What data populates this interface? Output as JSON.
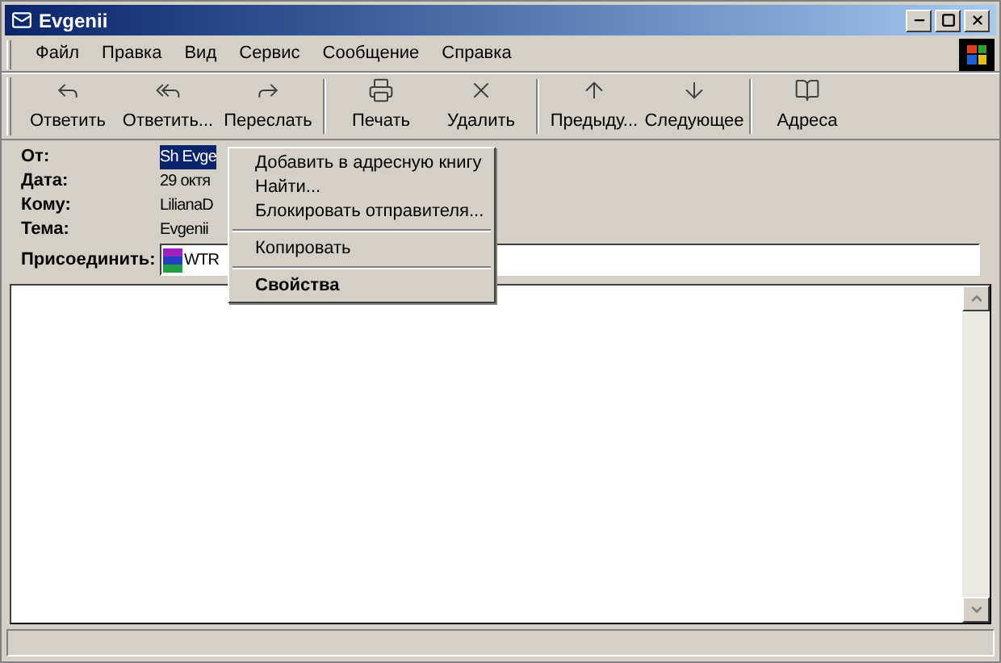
{
  "window": {
    "title": "Evgenii"
  },
  "menu_bar": [
    "Файл",
    "Правка",
    "Вид",
    "Сервис",
    "Сообщение",
    "Справка"
  ],
  "toolbar": [
    [
      "Ответить",
      "Ответить...",
      "Переслать"
    ],
    [
      "Печать",
      "Удалить"
    ],
    [
      "Предыду...",
      "Следующее"
    ],
    [
      "Адреса"
    ]
  ],
  "header": [
    {
      "label": "От:",
      "value": "Sh Evge",
      "selected": true
    },
    {
      "label": "Дата:",
      "value": "29 октя",
      "selected": false
    },
    {
      "label": "Кому:",
      "value": "LilianaD",
      "selected": false
    },
    {
      "label": "Тема:",
      "value": "Evgenii",
      "selected": false
    }
  ],
  "attach": {
    "label": "Присоединить:",
    "file": "WTR"
  },
  "context_menu": [
    [
      {
        "label": "Добавить в адресную книгу",
        "default": false
      },
      {
        "label": "Найти...",
        "default": false
      },
      {
        "label": "Блокировать отправителя...",
        "default": false
      }
    ],
    [
      {
        "label": "Копировать",
        "default": false
      }
    ],
    [
      {
        "label": "Свойства",
        "default": true
      }
    ]
  ]
}
